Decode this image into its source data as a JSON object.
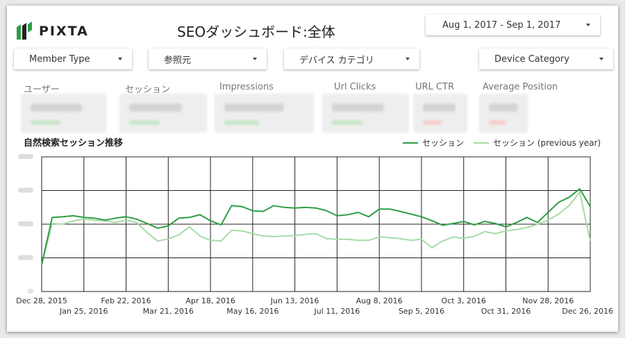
{
  "header": {
    "logo_text": "PIXTA",
    "title": "SEOダッシュボード:全体",
    "date_range": "Aug 1, 2017 - Sep 1, 2017"
  },
  "filters": [
    {
      "label": "Member Type"
    },
    {
      "label": "参照元"
    },
    {
      "label": "デバイス カテゴリ"
    },
    {
      "label": "Device Category"
    }
  ],
  "kpis": [
    {
      "label": "ユーザー"
    },
    {
      "label": "セッション"
    },
    {
      "label": "Impressions"
    },
    {
      "label": "Url Clicks"
    },
    {
      "label": "URL CTR"
    },
    {
      "label": "Average Position"
    }
  ],
  "colors": {
    "current": "#2e9e44",
    "previous": "#a6dba6",
    "grid": "#222222"
  },
  "chart_data": {
    "type": "line",
    "title": "自然検索セッション推移",
    "legend": [
      "セッション",
      "セッション (previous year)"
    ],
    "legend_position": "top-right",
    "x_ticks_row1": [
      "Dec 28, 2015",
      "Feb 22, 2016",
      "Apr 18, 2016",
      "Jun 13, 2016",
      "Aug 8, 2016",
      "Oct 3, 2016",
      "Nov 28, 2016"
    ],
    "x_ticks_row2": [
      "Jan 25, 2016",
      "Mar 21, 2016",
      "May 16, 2016",
      "Jul 11, 2016",
      "Sep 5, 2016",
      "Oct 31, 2016",
      "Dec 26, 2016"
    ],
    "x_count": 53,
    "ylim": [
      0,
      4
    ],
    "grid": true,
    "series": [
      {
        "name": "セッション",
        "values": [
          0.8,
          2.2,
          2.22,
          2.25,
          2.2,
          2.18,
          2.12,
          2.18,
          2.22,
          2.15,
          2.02,
          1.88,
          1.95,
          2.18,
          2.2,
          2.28,
          2.1,
          1.98,
          2.55,
          2.52,
          2.4,
          2.38,
          2.55,
          2.5,
          2.48,
          2.5,
          2.48,
          2.4,
          2.25,
          2.28,
          2.35,
          2.22,
          2.45,
          2.45,
          2.38,
          2.3,
          2.22,
          2.1,
          1.97,
          2.02,
          2.08,
          1.98,
          2.08,
          2.02,
          1.92,
          2.05,
          2.2,
          2.05,
          2.35,
          2.65,
          2.8,
          3.05,
          2.52
        ]
      },
      {
        "name": "セッション (previous year)",
        "values": [
          0.8,
          2.02,
          2.0,
          2.1,
          2.15,
          2.12,
          2.1,
          2.05,
          2.12,
          2.05,
          1.75,
          1.5,
          1.56,
          1.68,
          1.92,
          1.65,
          1.52,
          1.5,
          1.82,
          1.8,
          1.72,
          1.65,
          1.63,
          1.65,
          1.66,
          1.7,
          1.72,
          1.57,
          1.55,
          1.55,
          1.52,
          1.52,
          1.62,
          1.6,
          1.57,
          1.52,
          1.55,
          1.3,
          1.5,
          1.62,
          1.58,
          1.64,
          1.78,
          1.72,
          1.8,
          1.84,
          1.9,
          2.0,
          2.12,
          2.3,
          2.55,
          2.95,
          1.5
        ]
      }
    ]
  }
}
